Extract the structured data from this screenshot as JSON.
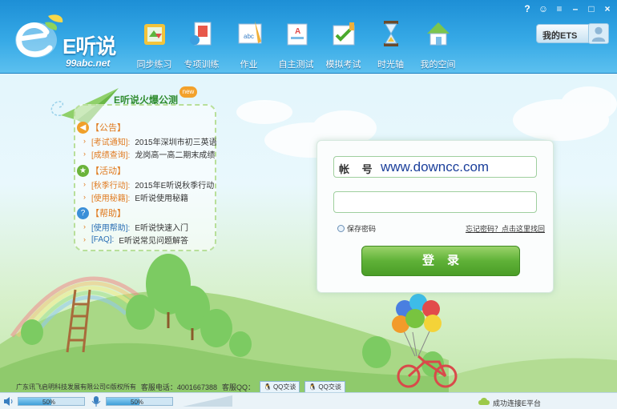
{
  "app": {
    "title": "E听说",
    "url": "99abc.net"
  },
  "nav": {
    "items": [
      {
        "label": "同步练习",
        "icon": "sync-practice-icon"
      },
      {
        "label": "专项训练",
        "icon": "special-training-icon"
      },
      {
        "label": "作业",
        "icon": "homework-icon"
      },
      {
        "label": "自主测试",
        "icon": "self-test-icon"
      },
      {
        "label": "模拟考试",
        "icon": "mock-exam-icon"
      },
      {
        "label": "时光轴",
        "icon": "timeline-icon"
      },
      {
        "label": "我的空间",
        "icon": "my-space-icon"
      }
    ]
  },
  "window": {
    "buttons": [
      "?",
      "☺",
      "≡",
      "–",
      "□",
      "×"
    ]
  },
  "my_ets": {
    "label": "我的ETS"
  },
  "board": {
    "title": "E听说火爆公测",
    "new_badge": "new",
    "sections": [
      {
        "name": "【公告】",
        "icon_color": "#f0a02a",
        "rows": [
          {
            "tag": "[考试通知]:",
            "text": "2015年深圳市初三英语"
          },
          {
            "tag": "[成绩查询]:",
            "text": "龙岗高一高二期末成绩"
          }
        ]
      },
      {
        "name": "【活动】",
        "icon_color": "#6bb33a",
        "rows": [
          {
            "tag": "[秋季行动]:",
            "text": "2015年E听说秋季行动"
          },
          {
            "tag": "[使用秘籍]:",
            "text": "E听说使用秘籍"
          }
        ]
      },
      {
        "name": "【帮助】",
        "icon_color": "#3a8fd8",
        "rows": [
          {
            "tag": "[使用帮助]:",
            "text": "E听说快速入门"
          },
          {
            "tag": "[FAQ]:",
            "text": "E听说常见问题解答"
          }
        ]
      }
    ]
  },
  "login": {
    "account_label": "帐 号",
    "account_value": "www.downcc.com",
    "password_value": "",
    "remember_label": "保存密码",
    "forgot_label": "忘记密码？点击这里找回",
    "submit_label": "登录"
  },
  "footer": {
    "copyright": "广东讯飞启明科技发展有限公司©版权所有",
    "hotline": "客服电话：4001667388",
    "qq_label": "客服QQ：",
    "qq_buttons": [
      "QQ交谈",
      "QQ交谈"
    ],
    "speaker_volume": "50%",
    "mic_volume": "50%",
    "speaker_level": 0.5,
    "mic_level": 0.5,
    "status": "成功连接E平台"
  }
}
